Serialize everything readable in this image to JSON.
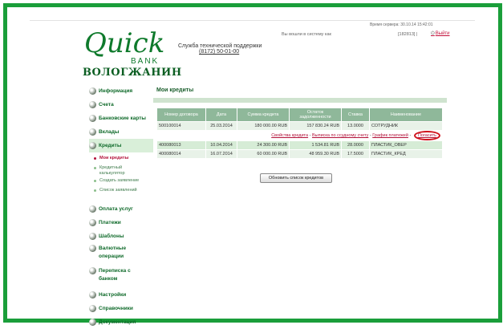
{
  "header": {
    "logo_main": "Quick",
    "logo_bank": "BANK",
    "logo_sub": "ВОЛОГЖАНИН",
    "support_label": "Служба технической поддержки",
    "support_phone": "(8172) 50-01-00",
    "session_time": "Время сервера: 30.10.14 15:42:01",
    "logged_in_text": "Вы вошли в систему как",
    "user_id": "[182813]  |",
    "logout_label": "Выйти"
  },
  "sidebar": {
    "items": [
      {
        "label": "Информация"
      },
      {
        "label": "Счета"
      },
      {
        "label": "Банковские карты"
      },
      {
        "label": "Вклады"
      },
      {
        "label": "Кредиты"
      }
    ],
    "credit_sub": [
      {
        "label": "Мои кредиты"
      },
      {
        "label": "Кредитный калькулятор"
      },
      {
        "label": "Создать заявление"
      },
      {
        "label": "Список заявлений"
      }
    ],
    "items2": [
      {
        "label": "Оплата услуг"
      },
      {
        "label": "Платежи"
      },
      {
        "label": "Шаблоны"
      },
      {
        "label": "Валютные операции"
      },
      {
        "label": "Переписка с банком"
      },
      {
        "label": "Настройки"
      },
      {
        "label": "Справочники"
      },
      {
        "label": "Документация"
      }
    ]
  },
  "main": {
    "title": "Мои кредиты",
    "columns": [
      "Номер договора",
      "Дата",
      "Сумма кредита",
      "Остаток задолженности",
      "Ставка",
      "Наименование"
    ],
    "rows": [
      {
        "contract": "500100014",
        "date": "25.03.2014",
        "amount": "180 000.00 RUB",
        "balance": "157 830.24 RUB",
        "rate": "13.0000",
        "name": "СОТРУДНИК"
      },
      {
        "contract": "400080013",
        "date": "10.04.2014",
        "amount": "24 300.00 RUB",
        "balance": "1 534.81 RUB",
        "rate": "28.0000",
        "name": "ПЛАСТИК_ОВЕР"
      },
      {
        "contract": "400080014",
        "date": "16.07.2014",
        "amount": "60 000.00 RUB",
        "balance": "48 959.30 RUB",
        "rate": "17.5000",
        "name": "ПЛАСТИК_КРЕД"
      }
    ],
    "actions": {
      "props": "Свойства кредита",
      "statement": "Выписка по ссудному счету",
      "schedule": "График платежей",
      "repay": "Погасить"
    },
    "refresh_button": "Обновить список кредитов"
  }
}
